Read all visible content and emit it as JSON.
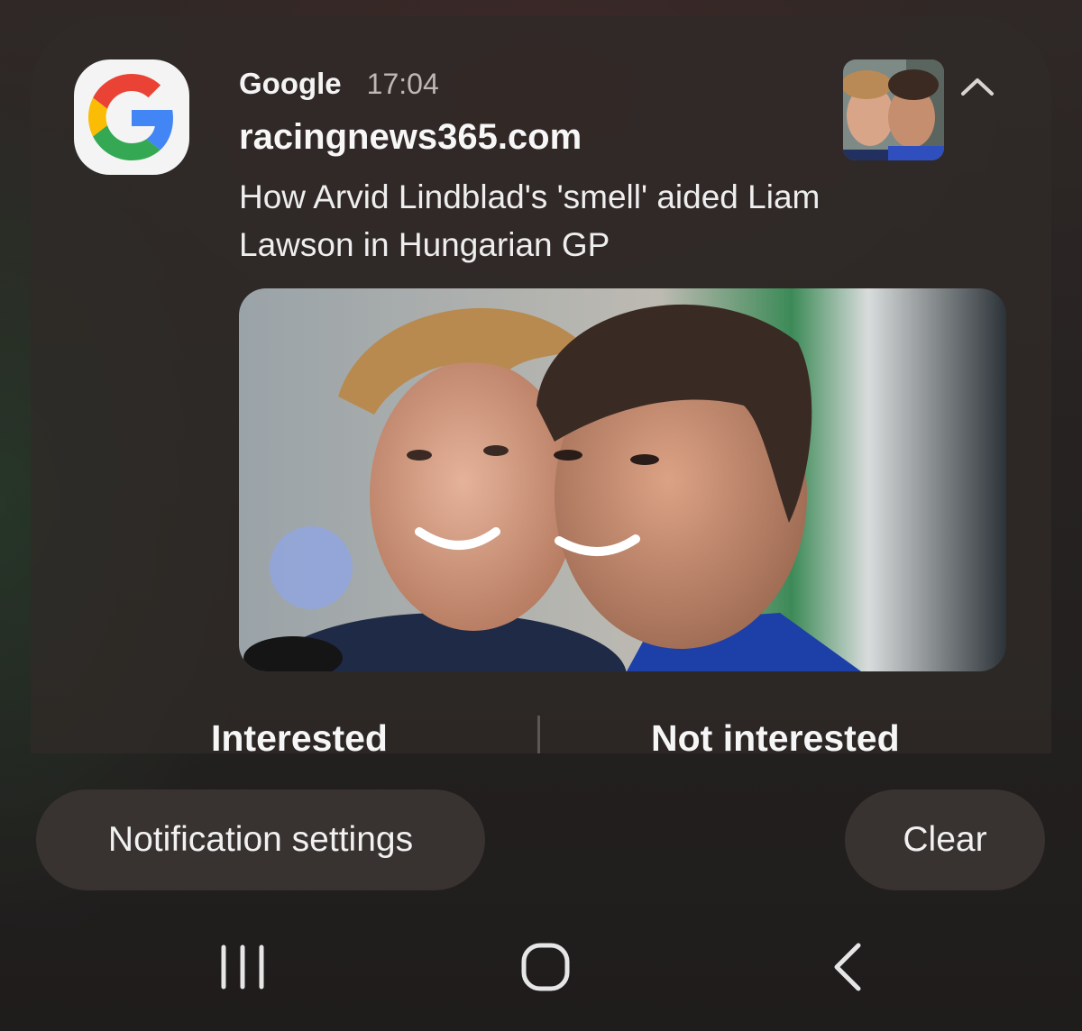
{
  "notification": {
    "app_name": "Google",
    "time": "17:04",
    "source": "racingnews365.com",
    "headline": "How Arvid Lindblad's 'smell' aided Liam Lawson in Hungarian GP",
    "app_icon": "google-g-icon",
    "collapse_icon": "chevron-up-icon",
    "actions": {
      "interested": "Interested",
      "not_interested": "Not interested"
    }
  },
  "buttons": {
    "notification_settings": "Notification settings",
    "clear": "Clear"
  },
  "navbar": {
    "recents_icon": "recents-icon",
    "home_icon": "home-icon",
    "back_icon": "back-icon"
  },
  "colors": {
    "google_blue": "#4285F4",
    "google_red": "#EA4335",
    "google_yellow": "#FBBC05",
    "google_green": "#34A853",
    "card_bg": "#302a28"
  }
}
